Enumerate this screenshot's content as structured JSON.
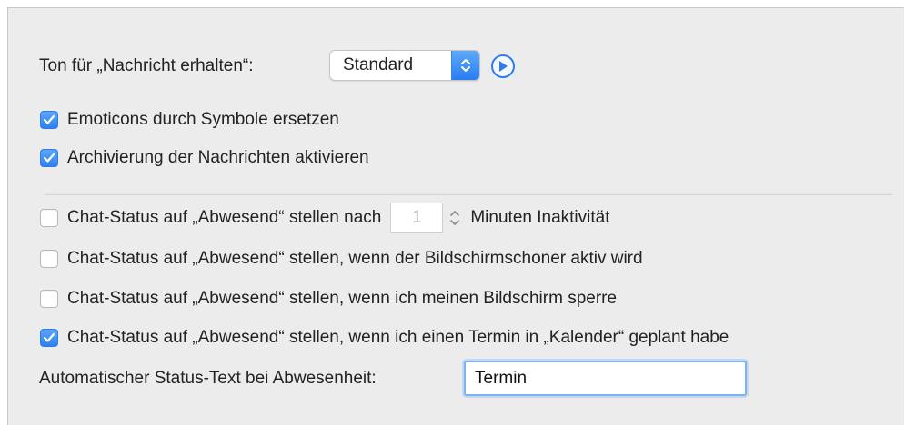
{
  "sound": {
    "label": "Ton für „Nachricht erhalten“:",
    "selected_value": "Standard"
  },
  "options": {
    "emoticons": {
      "label": "Emoticons durch Symbole ersetzen",
      "checked": true
    },
    "archive": {
      "label": "Archivierung der Nachrichten aktivieren",
      "checked": true
    }
  },
  "away": {
    "inactivity": {
      "label_prefix": "Chat-Status auf „Abwesend“ stellen nach",
      "minutes": "1",
      "label_suffix": "Minuten Inaktivität",
      "checked": false
    },
    "screensaver": {
      "label": "Chat-Status auf „Abwesend“ stellen, wenn der Bildschirmschoner aktiv wird",
      "checked": false
    },
    "lock": {
      "label": "Chat-Status auf „Abwesend“ stellen, wenn ich meinen Bildschirm sperre",
      "checked": false
    },
    "calendar": {
      "label": "Chat-Status auf „Abwesend“ stellen, wenn ich einen Termin in „Kalender“ geplant habe",
      "checked": true
    },
    "status_text": {
      "label": "Automatischer Status-Text bei Abwesenheit:",
      "value": "Termin"
    }
  },
  "colors": {
    "accent": "#2f7cf0",
    "panel_bg": "#ececec"
  },
  "icons": [
    "chevron-up-down-icon",
    "play-icon",
    "checkmark-icon",
    "stepper-icon"
  ]
}
